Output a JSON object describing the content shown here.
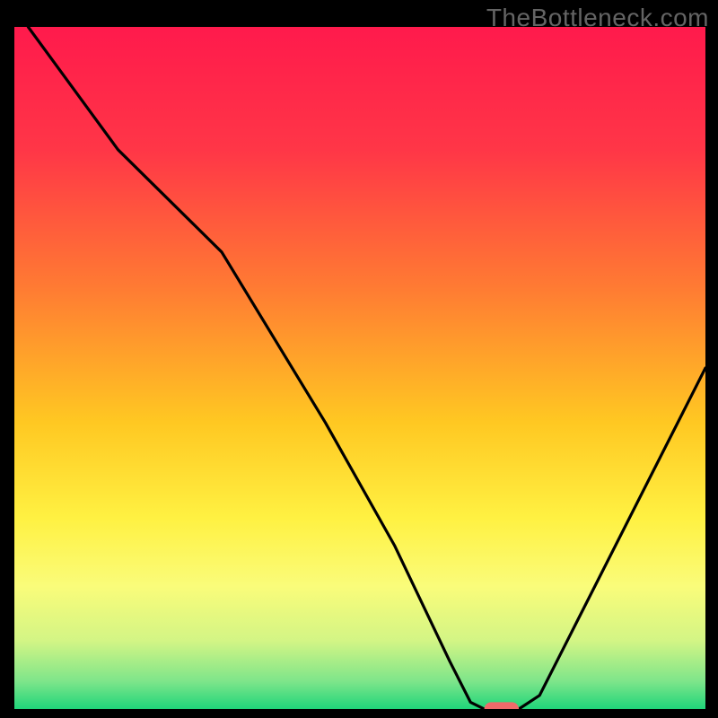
{
  "watermark": "TheBottleneck.com",
  "chart_data": {
    "type": "line",
    "title": "",
    "xlabel": "",
    "ylabel": "",
    "xlim": [
      0,
      100
    ],
    "ylim": [
      0,
      100
    ],
    "gradient_stops": [
      {
        "offset": 0.0,
        "color": "#ff1a4c"
      },
      {
        "offset": 0.18,
        "color": "#ff3647"
      },
      {
        "offset": 0.38,
        "color": "#ff7a33"
      },
      {
        "offset": 0.58,
        "color": "#ffc822"
      },
      {
        "offset": 0.72,
        "color": "#fff142"
      },
      {
        "offset": 0.82,
        "color": "#fafc7a"
      },
      {
        "offset": 0.9,
        "color": "#d3f585"
      },
      {
        "offset": 0.96,
        "color": "#7de58a"
      },
      {
        "offset": 1.0,
        "color": "#1fd57a"
      }
    ],
    "curve": [
      {
        "x": 2,
        "y": 100
      },
      {
        "x": 15,
        "y": 82
      },
      {
        "x": 25,
        "y": 72
      },
      {
        "x": 30,
        "y": 67
      },
      {
        "x": 45,
        "y": 42
      },
      {
        "x": 55,
        "y": 24
      },
      {
        "x": 63,
        "y": 7
      },
      {
        "x": 66,
        "y": 1
      },
      {
        "x": 68,
        "y": 0
      },
      {
        "x": 73,
        "y": 0
      },
      {
        "x": 76,
        "y": 2
      },
      {
        "x": 85,
        "y": 20
      },
      {
        "x": 95,
        "y": 40
      },
      {
        "x": 100,
        "y": 50
      }
    ],
    "marker": {
      "x": 70.5,
      "y": 0,
      "w": 5,
      "h": 2,
      "color": "#f06a6a"
    }
  }
}
